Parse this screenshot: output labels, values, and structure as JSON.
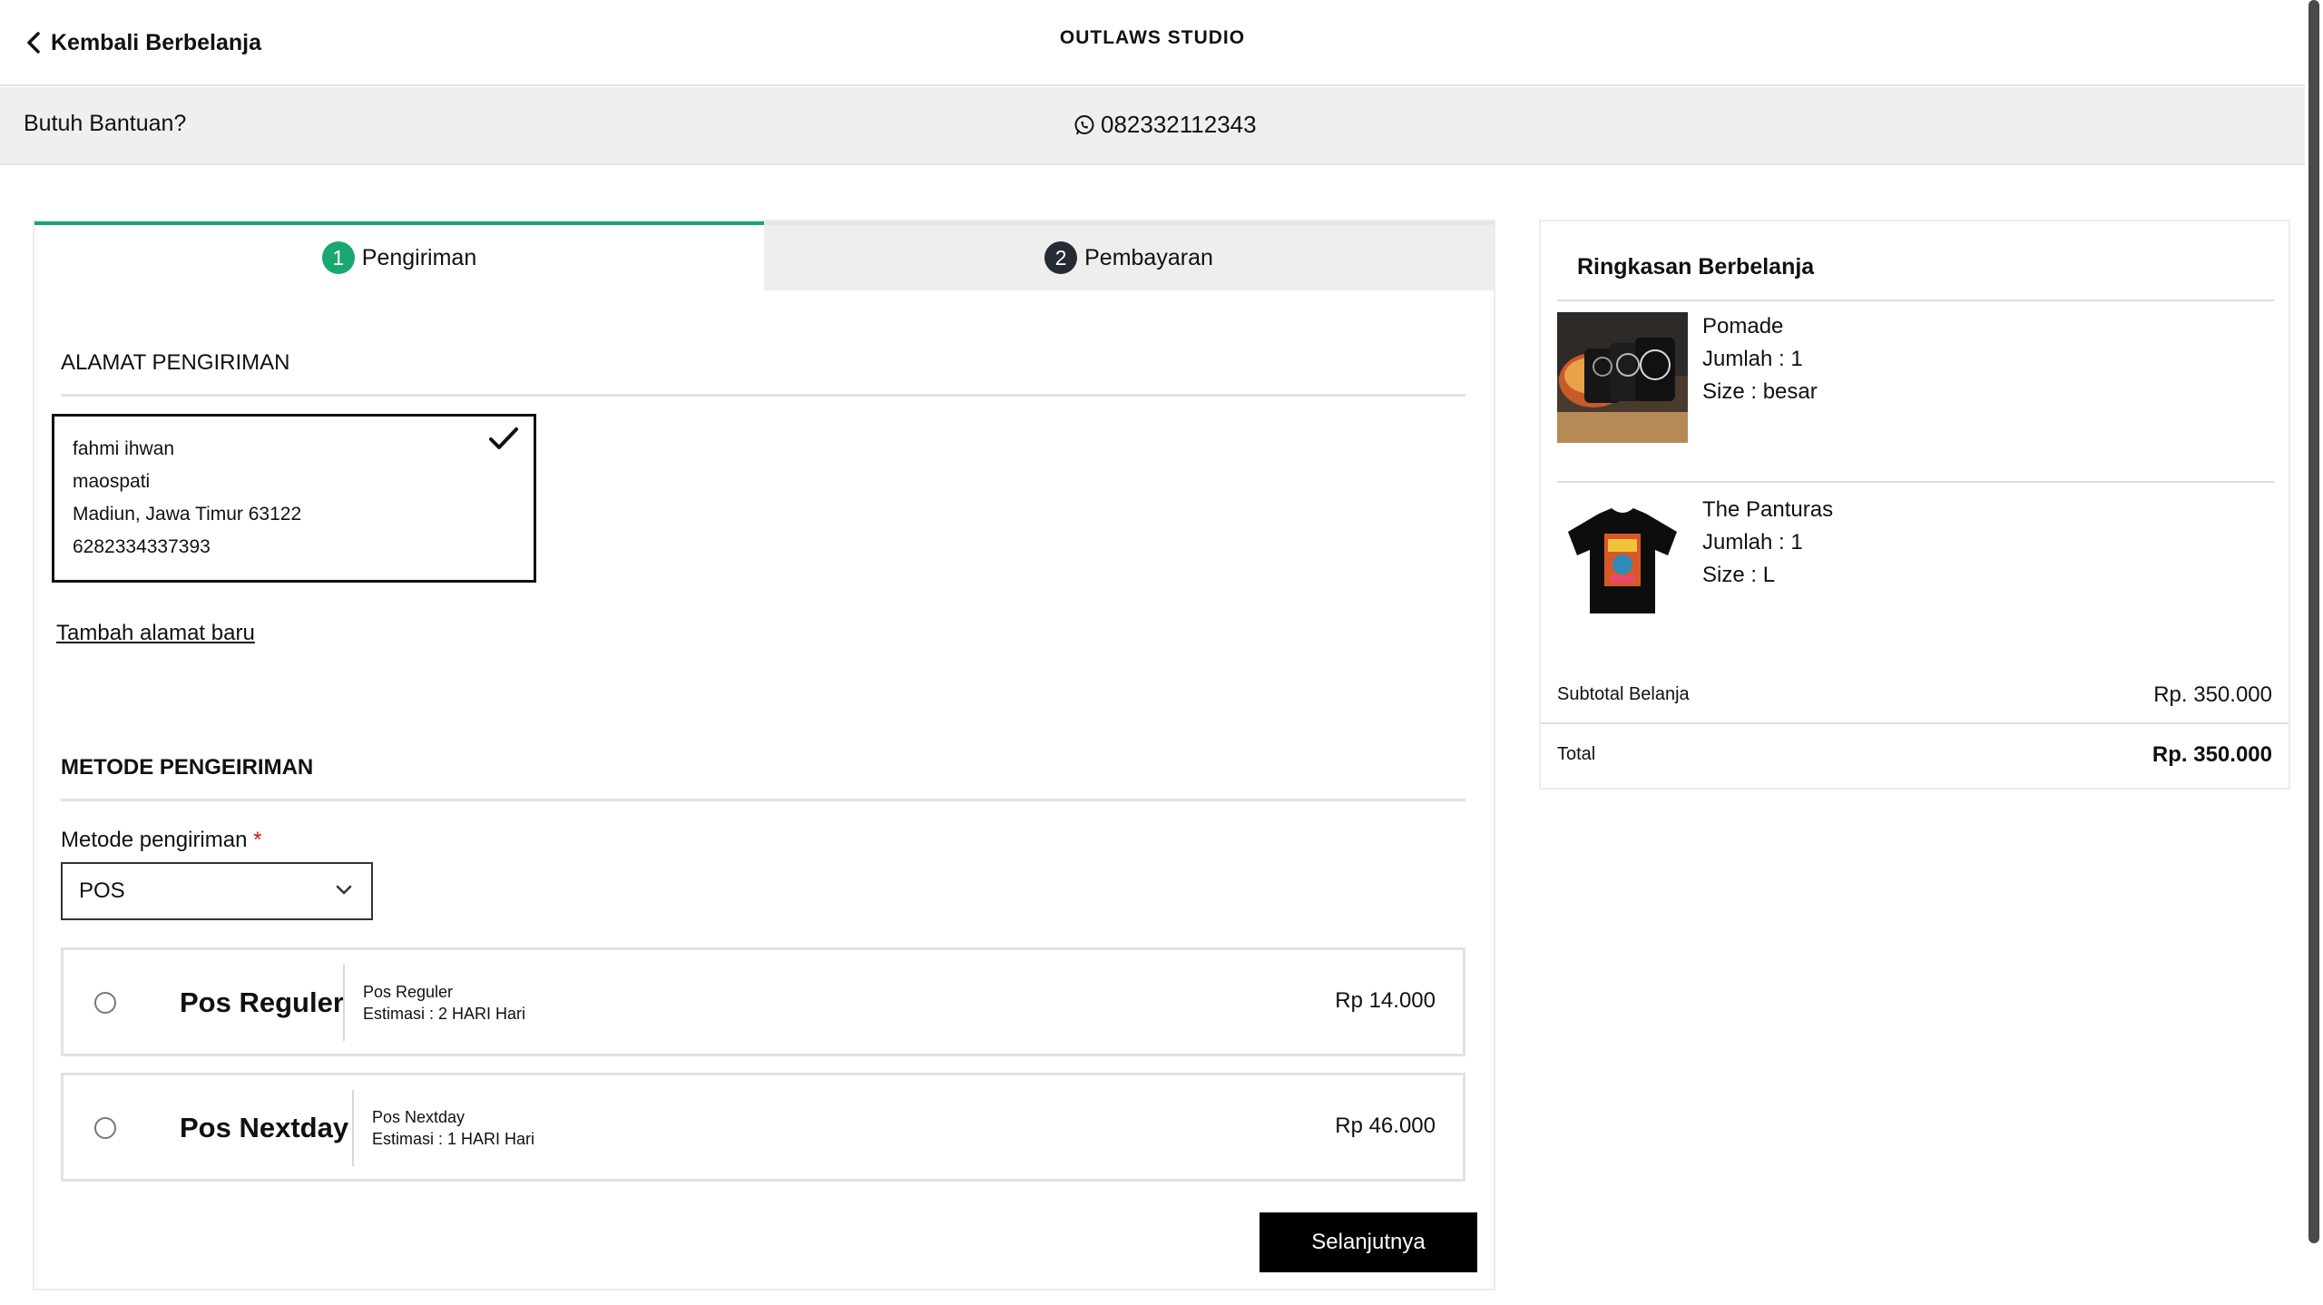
{
  "header": {
    "back_label": "Kembali Berbelanja",
    "brand": "OUTLAWS STUDIO"
  },
  "help": {
    "text": "Butuh Bantuan?",
    "phone": "082332112343",
    "phone_icon": "whatsapp-icon"
  },
  "steps": [
    {
      "number": "1",
      "label": "Pengiriman",
      "active": true
    },
    {
      "number": "2",
      "label": "Pembayaran",
      "active": false
    }
  ],
  "address": {
    "section_title": "ALAMAT PENGIRIMAN",
    "lines": [
      "fahmi ihwan",
      "maospati",
      "Madiun, Jawa Timur 63122",
      "6282334337393"
    ],
    "add_label": "Tambah alamat baru"
  },
  "shipping": {
    "section_title": "METODE PENGEIRIMAN",
    "field_label": "Metode pengiriman",
    "required_mark": "*",
    "selected": "POS",
    "options": [
      {
        "name": "Pos Reguler",
        "service": "Pos Reguler",
        "estimate": "Estimasi : 2 HARI Hari",
        "price": "Rp 14.000"
      },
      {
        "name": "Pos Nextday",
        "service": "Pos Nextday",
        "estimate": "Estimasi : 1 HARI Hari",
        "price": "Rp 46.000"
      }
    ],
    "next_label": "Selanjutnya"
  },
  "summary": {
    "title": "Ringkasan Berbelanja",
    "items": [
      {
        "name": "Pomade",
        "qty": "Jumlah : 1",
        "size": "Size : besar"
      },
      {
        "name": "The Panturas",
        "qty": "Jumlah : 1",
        "size": "Size : L"
      }
    ],
    "subtotal_label": "Subtotal Belanja",
    "subtotal_value": "Rp. 350.000",
    "total_label": "Total",
    "total_value": "Rp. 350.000"
  },
  "colors": {
    "accent": "#19a870",
    "step_inactive": "#252a33",
    "button": "#000000"
  }
}
